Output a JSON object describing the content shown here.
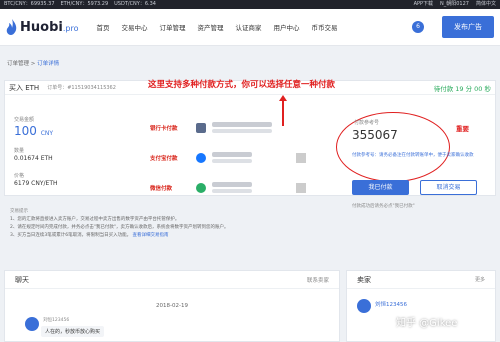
{
  "ticker": {
    "btc": "BTC/CNY：69935.37",
    "eth": "ETH/CNY：5973.29",
    "usdt": "USDT/CNY：6.34",
    "app_download": "APP下载",
    "user": "N_朝阳0127",
    "language": "简体中文"
  },
  "nav": {
    "logo_main": "Huobi",
    "logo_suffix": ".pro",
    "items": [
      "首页",
      "交易中心",
      "订单管理",
      "资产管理",
      "认证商家",
      "用户中心",
      "币币交易"
    ],
    "notification_count": "6",
    "publish_label": "发布广告"
  },
  "breadcrumb": {
    "parent": "订单管理",
    "separator": " > ",
    "current": "订单详情"
  },
  "order": {
    "title": "买入 ETH",
    "number": "订单号：#11519034115362",
    "countdown": "待付款 19 分 00 秒",
    "amount_label": "交易金额",
    "amount_value": "100",
    "amount_unit": "CNY",
    "quantity_label": "数量",
    "quantity_value": "0.01674 ETH",
    "price_label": "价格",
    "price_value": "6179 CNY/ETH"
  },
  "payments": {
    "bank": "银行卡付款",
    "alipay": "支付宝付款",
    "wechat": "微信付款"
  },
  "annotation": {
    "text": "这里支持多种付款方式，你可以选择任意一种付款",
    "important": "重要"
  },
  "reference": {
    "label": "付款参考号",
    "code": "355067",
    "note": "付款参考号：请务必备注在付款转账单中，便于卖家确认收款"
  },
  "actions": {
    "paid": "我已付款",
    "cancel": "取消交易",
    "paid_tip": "付款成功后请务必点\"我已付款\""
  },
  "tips": {
    "title": "交易提示",
    "line1": "1、您的汇款将直接进入卖方账户，交易过程中卖方出售的数字资产由平台托管保护。",
    "line2": "2、请在规定时间内完成付款，并务必点击\"我已付款\"，卖方确认收款后，系统会将数字资产划转到您的账户。",
    "line3": "3、买方当日连续3笔或累计6笔取消，将限制当日买入功能。",
    "more": "查看详细交易指南"
  },
  "chat": {
    "title": "聊天",
    "contact": "联系卖家",
    "date": "2018-02-19",
    "user": "刘恒123456",
    "message": "人在的，秒放币放心购买"
  },
  "seller": {
    "title": "卖家",
    "more": "更多",
    "name": "刘恒123456"
  },
  "watermark": "知乎 @Gikee",
  "colors": {
    "accent": "#3a6fd8",
    "annotation": "#e02020",
    "countdown": "#2aab5d"
  }
}
